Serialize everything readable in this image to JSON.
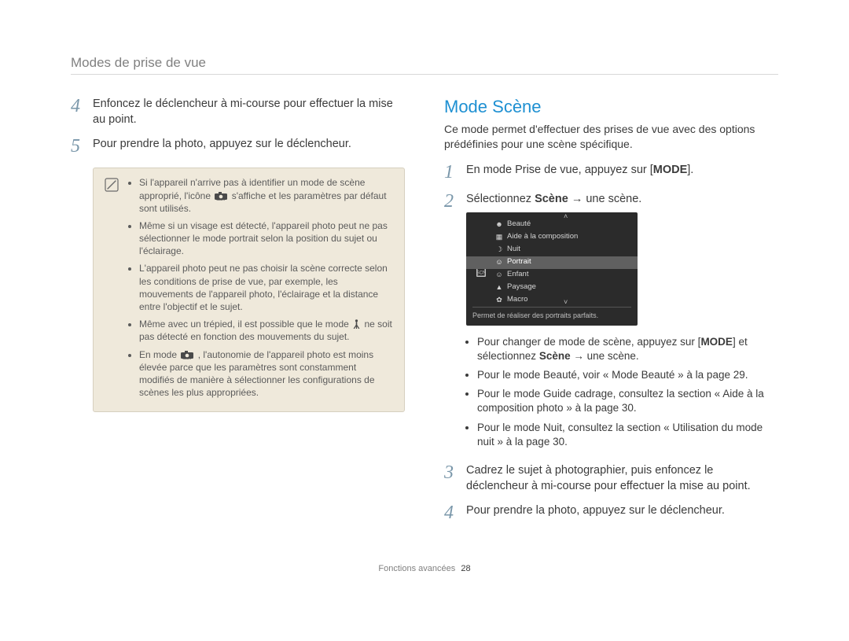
{
  "running_head": "Modes de prise de vue",
  "left": {
    "step4": "Enfoncez le déclencheur à mi-course pour effectuer la mise au point.",
    "step5": "Pour prendre la photo, appuyez sur le déclencheur.",
    "notes": {
      "b1a": "Si l'appareil n'arrive pas à identifier un mode de scène approprié, l'icône ",
      "b1b": " s'affiche et les paramètres par défaut sont utilisés.",
      "b2": "Même si un visage est détecté, l'appareil photo peut ne pas sélectionner le mode portrait selon la position du sujet ou l'éclairage.",
      "b3": "L'appareil photo peut ne pas choisir la scène correcte selon les conditions de prise de vue, par exemple, les mouvements de l'appareil photo, l'éclairage et la distance entre l'objectif et le sujet.",
      "b4a": "Même avec un trépied, il est possible que le mode ",
      "b4b": " ne soit pas détecté en fonction des mouvements du sujet.",
      "b5a": "En mode ",
      "b5b": " , l'autonomie de l'appareil photo est moins élevée parce que les paramètres sont constamment modifiés de manière à sélectionner les configurations de scènes les plus appropriées."
    }
  },
  "right": {
    "heading": "Mode Scène",
    "intro": "Ce mode permet d'effectuer des prises de vue avec des options prédéfinies pour une scène spécifique.",
    "step1_pre": "En mode Prise de vue, appuyez sur [",
    "step1_mode": "MODE",
    "step1_post": "].",
    "step2": "Sélectionnez Scène → une scène.",
    "step2_bold": "Scène",
    "lcd": {
      "items": [
        "Beauté",
        "Aide à la composition",
        "Nuit",
        "Portrait",
        "Enfant",
        "Paysage",
        "Macro"
      ],
      "selected_index": 3,
      "desc": "Permet de réaliser des portraits parfaits."
    },
    "bul1_a": "Pour changer de mode de scène, appuyez sur [",
    "bul1_mode": "MODE",
    "bul1_b": "] et sélectionnez ",
    "bul1_bold": "Scène",
    "bul1_c": " → une scène.",
    "bul2": "Pour le mode Beauté, voir « Mode Beauté » à la page 29.",
    "bul3": "Pour le mode Guide cadrage, consultez la section « Aide à la composition photo » à la page 30.",
    "bul4": "Pour le mode Nuit, consultez la section « Utilisation du mode nuit » à la page 30.",
    "step3": "Cadrez le sujet à photographier, puis enfoncez le déclencheur à mi-course pour effectuer la mise au point.",
    "step4": "Pour prendre la photo, appuyez sur le déclencheur."
  },
  "footer": {
    "section": "Fonctions avancées",
    "page": "28"
  }
}
